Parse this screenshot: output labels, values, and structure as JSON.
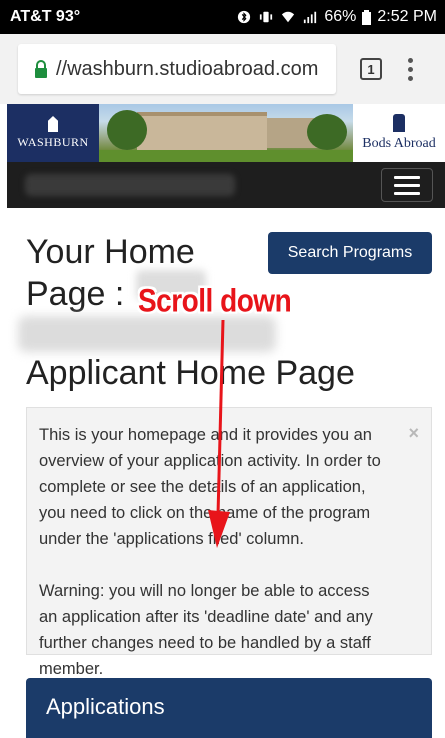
{
  "status_bar": {
    "carrier": "AT&T 93°",
    "battery": "66%",
    "time": "2:52 PM"
  },
  "browser": {
    "url": "//washburn.studioabroad.com",
    "tab_count": "1"
  },
  "banner": {
    "left_logo": "WASHBURN",
    "right_logo": "Bods Abroad"
  },
  "page": {
    "home_title_line1": "Your Home",
    "home_title_line2": "Page :",
    "search_button": "Search Programs",
    "section_title": "Applicant Home Page",
    "alert_para1": "This is your homepage and it provides you an overview of your application activity. In order to complete or see the details of an application, you need to click on the name of the program under the 'applications filed' column.",
    "alert_para2": "Warning: you will no longer be able to access an application after its 'deadline date' and any further changes need to be handled by a staff member.",
    "alert_close": "×",
    "panel_title": "Applications"
  },
  "annotation": {
    "label": "Scroll down",
    "color": "#e8141a"
  },
  "colors": {
    "primary": "#1b3b69",
    "nav": "#1e1e1e"
  }
}
